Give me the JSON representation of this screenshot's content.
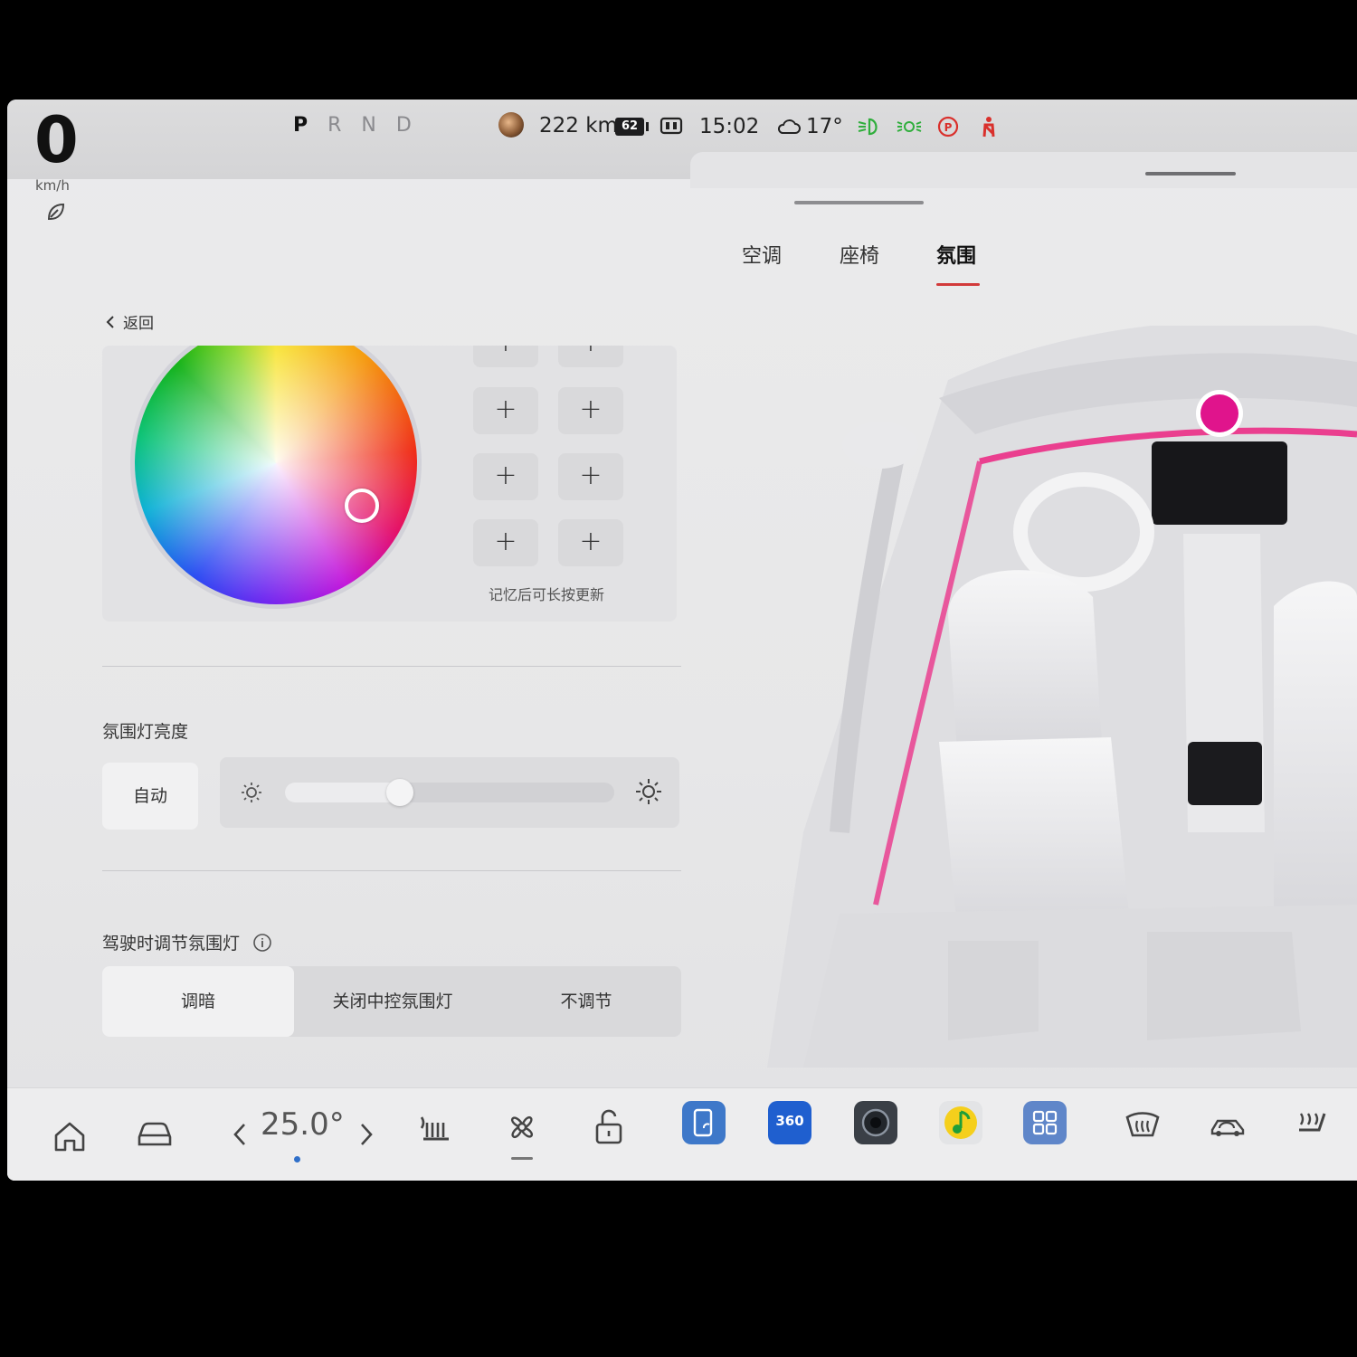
{
  "status_bar": {
    "speed": "0",
    "speed_unit": "km/h",
    "gears": [
      "P",
      "R",
      "N",
      "D"
    ],
    "active_gear": "P",
    "range": "222 km",
    "battery_percent": "62",
    "clock": "15:02",
    "outside_temp": "17°"
  },
  "tabs": [
    {
      "label": "空调",
      "active": false
    },
    {
      "label": "座椅",
      "active": false
    },
    {
      "label": "氛围",
      "active": true
    }
  ],
  "back_label": "返回",
  "color_panel": {
    "selected_color": "#e0148c",
    "memory_hint": "记忆后可长按更新"
  },
  "brightness": {
    "title": "氛围灯亮度",
    "auto_label": "自动",
    "level_fraction": 0.35
  },
  "driving_adjust": {
    "title": "驾驶时调节氛围灯",
    "options": [
      "调暗",
      "关闭中控氛围灯",
      "不调节"
    ],
    "selected": "调暗"
  },
  "dock": {
    "cabin_temp": "25.0°",
    "app_360_label": "360"
  },
  "colors": {
    "accent_red": "#d23a3a",
    "ambient_pink": "#e0148c",
    "app_blue": "#2f6fc9"
  }
}
